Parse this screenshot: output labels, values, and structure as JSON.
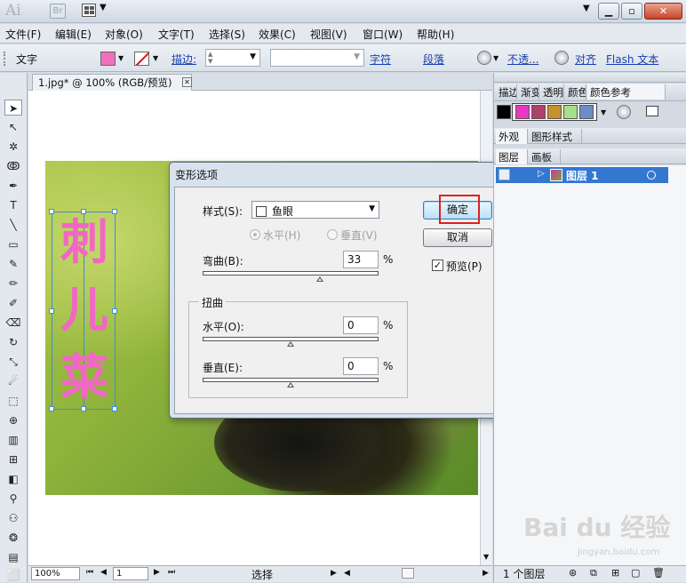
{
  "titlebar": {
    "app_logo": "Ai",
    "bridge_label": "Br"
  },
  "menu": [
    "文件(F)",
    "编辑(E)",
    "对象(O)",
    "文字(T)",
    "选择(S)",
    "效果(C)",
    "视图(V)",
    "窗口(W)",
    "帮助(H)"
  ],
  "control": {
    "label": "文字",
    "stroke_label": "描边:",
    "char_link": "字符",
    "para_link": "段落",
    "opacity_link": "不透...",
    "align_link": "对齐",
    "flash_text_link": "Flash 文本",
    "fill_color": "#f06fbf"
  },
  "document": {
    "tab_title": "1.jpg* @ 100% (RGB/预览)",
    "art_text": [
      "刺",
      "儿",
      "菜"
    ],
    "art_text_color": "#f266c6"
  },
  "dialog": {
    "title": "变形选项",
    "style_label": "样式(S):",
    "style_value": "鱼眼",
    "horizontal_radio": "水平(H)",
    "vertical_radio": "垂直(V)",
    "bend_label": "弯曲(B):",
    "bend_value": "33",
    "percent": "%",
    "distort_label": "扭曲",
    "dist_h_label": "水平(O):",
    "dist_h_value": "0",
    "dist_v_label": "垂直(E):",
    "dist_v_value": "0",
    "ok_label": "确定",
    "cancel_label": "取消",
    "preview_label": "预览(P)"
  },
  "panels": {
    "top_tabs": [
      "描边",
      "渐变",
      "透明",
      "颜色",
      "颜色参考"
    ],
    "swatch_colors": [
      "#ffffff",
      "#e838c0",
      "#b0406e",
      "#c8902f",
      "#a7e08a",
      "#6a8fc8"
    ],
    "mid_tabs": [
      "外观",
      "图形样式"
    ],
    "layer_tabs": [
      "图层",
      "画板"
    ],
    "layer_name": "图层 1",
    "layer_count": "1 个图层"
  },
  "status": {
    "zoom": "100%",
    "artboard": "1",
    "text": "选择"
  },
  "watermark": {
    "brand": "Bai du 经验",
    "url": "jingyan.baidu.com"
  }
}
